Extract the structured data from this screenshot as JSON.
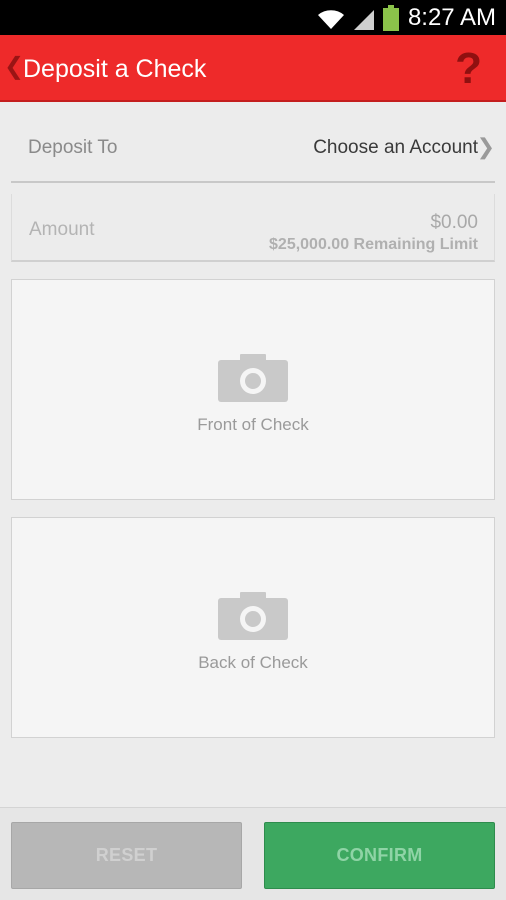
{
  "status_bar": {
    "time": "8:27 AM",
    "icons": [
      "wifi-icon",
      "signal-icon",
      "battery-icon"
    ]
  },
  "app_bar": {
    "back_glyph": "❮",
    "title": "Deposit a Check",
    "help_glyph": "?"
  },
  "deposit_to": {
    "label": "Deposit To",
    "value": "Choose an Account",
    "chevron": "❯"
  },
  "amount": {
    "label": "Amount",
    "value": "$0.00",
    "remaining_limit": "$25,000.00 Remaining Limit"
  },
  "front_check": {
    "label": "Front of Check",
    "icon": "camera-icon"
  },
  "back_check": {
    "label": "Back of Check",
    "icon": "camera-icon"
  },
  "buttons": {
    "reset": "RESET",
    "confirm": "CONFIRM"
  },
  "colors": {
    "brand_red": "#ee2a2a",
    "confirm_green": "#3da860",
    "reset_gray": "#b7b7b7"
  }
}
